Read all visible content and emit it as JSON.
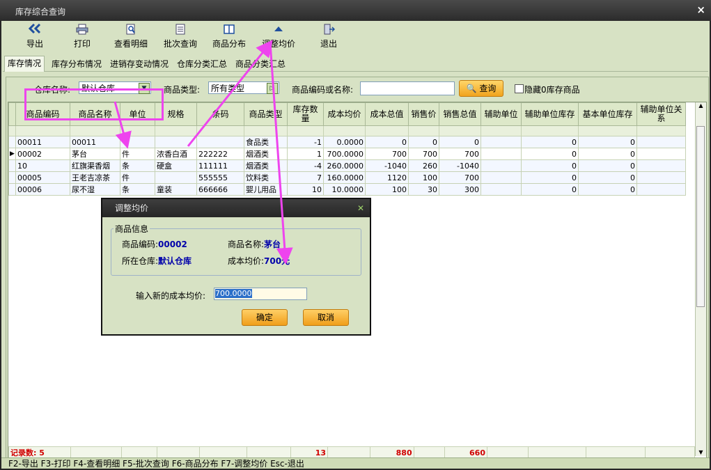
{
  "window": {
    "title": "库存综合查询",
    "close": "×"
  },
  "toolbar": [
    {
      "label": "导出",
      "icon": "double-chevron-left-icon"
    },
    {
      "label": "打印",
      "icon": "printer-icon"
    },
    {
      "label": "查看明细",
      "icon": "magnifier-doc-icon"
    },
    {
      "label": "批次查询",
      "icon": "list-doc-icon"
    },
    {
      "label": "商品分布",
      "icon": "columns-icon"
    },
    {
      "label": "调整均价",
      "icon": "triangle-up-icon"
    },
    {
      "label": "退出",
      "icon": "exit-door-icon"
    }
  ],
  "tabs": [
    "库存情况",
    "库存分布情况",
    "进销存变动情况",
    "仓库分类汇总",
    "商品分类汇总"
  ],
  "filter": {
    "warehouse_label": "仓库名称:",
    "warehouse_value": "默认仓库",
    "type_label": "商品类型:",
    "type_value": "所有类型",
    "code_label": "商品编码或名称:",
    "code_value": "",
    "query_button": "查询",
    "hide_zero_label": "隐藏0库存商品",
    "hide_zero_checked": false
  },
  "table": {
    "columns": [
      "商品编码",
      "商品名称",
      "单位",
      "规格",
      "条码",
      "商品类型",
      "库存数量",
      "成本均价",
      "成本总值",
      "销售价",
      "销售总值",
      "辅助单位",
      "辅助单位库存",
      "基本单位库存",
      "辅助单位关系"
    ],
    "rows": [
      [
        "00011",
        "00011",
        "",
        "",
        "",
        "食品类",
        "-1",
        "0.0000",
        "0",
        "0",
        "0",
        "",
        "0",
        "0",
        ""
      ],
      [
        "00002",
        "茅台",
        "件",
        "浓香白酒",
        "222222",
        "烟酒类",
        "1",
        "700.0000",
        "700",
        "700",
        "700",
        "",
        "0",
        "0",
        ""
      ],
      [
        "10",
        "红旗渠香烟",
        "条",
        "硬盒",
        "111111",
        "烟酒类",
        "-4",
        "260.0000",
        "-1040",
        "260",
        "-1040",
        "",
        "0",
        "0",
        ""
      ],
      [
        "00005",
        "王老吉凉茶",
        "件",
        "",
        "555555",
        "饮料类",
        "7",
        "160.0000",
        "1120",
        "100",
        "700",
        "",
        "0",
        "0",
        ""
      ],
      [
        "00006",
        "尿不湿",
        "条",
        "童装",
        "666666",
        "婴儿用品",
        "10",
        "10.0000",
        "100",
        "30",
        "300",
        "",
        "0",
        "0",
        ""
      ]
    ],
    "selected_row": 1,
    "footer": {
      "record_count": "记录数: 5",
      "qty_total": "13",
      "cost_total": "880",
      "sales_total": "660"
    }
  },
  "statusbar": "F2-导出 F3-打印 F4-查看明细 F5-批次查询 F6-商品分布 F7-调整均价 Esc-退出",
  "dialog": {
    "title": "调整均价",
    "group": "商品信息",
    "code_label": "商品编码:",
    "code_value": "00002",
    "name_label": "商品名称:",
    "name_value": "茅台",
    "warehouse_label": "所在仓库:",
    "warehouse_value": "默认仓库",
    "cost_label": "成本均价:",
    "cost_value": "700元",
    "input_label": "输入新的成本均价:",
    "input_value": "700.0000",
    "ok": "确定",
    "cancel": "取消"
  },
  "colors": {
    "accent_annotation": "#ee44ee",
    "button_orange": "#f1a31d",
    "panel_bg": "#d7e2c4",
    "footer_text": "#d00000"
  }
}
